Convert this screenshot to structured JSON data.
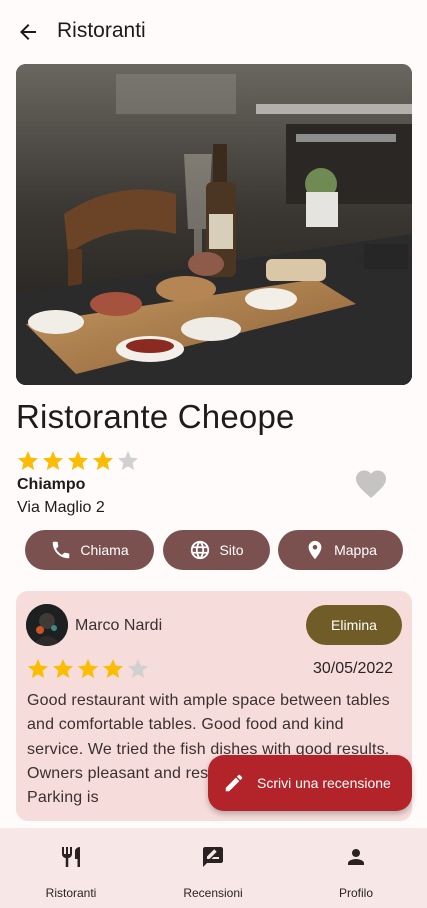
{
  "appbar": {
    "title": "Ristoranti",
    "back_icon": "arrow-back-icon"
  },
  "restaurant": {
    "name": "Ristorante Cheope",
    "rating": 4,
    "rating_max": 5,
    "city": "Chiampo",
    "address": "Via Maglio 2",
    "favorite": false
  },
  "actions": {
    "call_label": "Chiama",
    "site_label": "Sito",
    "map_label": "Mappa"
  },
  "review": {
    "author": "Marco Nardi",
    "delete_label": "Elimina",
    "rating": 4,
    "rating_max": 5,
    "date": "30/05/2022",
    "text": "Good restaurant with ample space between tables and comfortable tables. Good food and kind service. We tried the fish dishes with good results. Owners pleasant and respectful of anticovid rules. Parking is"
  },
  "fab": {
    "label": "Scrivi una recensione"
  },
  "bottom_nav": {
    "items": [
      {
        "label": "Ristoranti",
        "icon": "restaurant-icon"
      },
      {
        "label": "Recensioni",
        "icon": "rate-review-icon"
      },
      {
        "label": "Profilo",
        "icon": "person-icon"
      }
    ]
  },
  "colors": {
    "primary": "#7b5150",
    "star": "#fbbc04",
    "star_empty": "#c9c9c9",
    "card": "#f6dcdb",
    "delete": "#705c27",
    "fab": "#b3242a",
    "nav": "#f7e7e6"
  }
}
